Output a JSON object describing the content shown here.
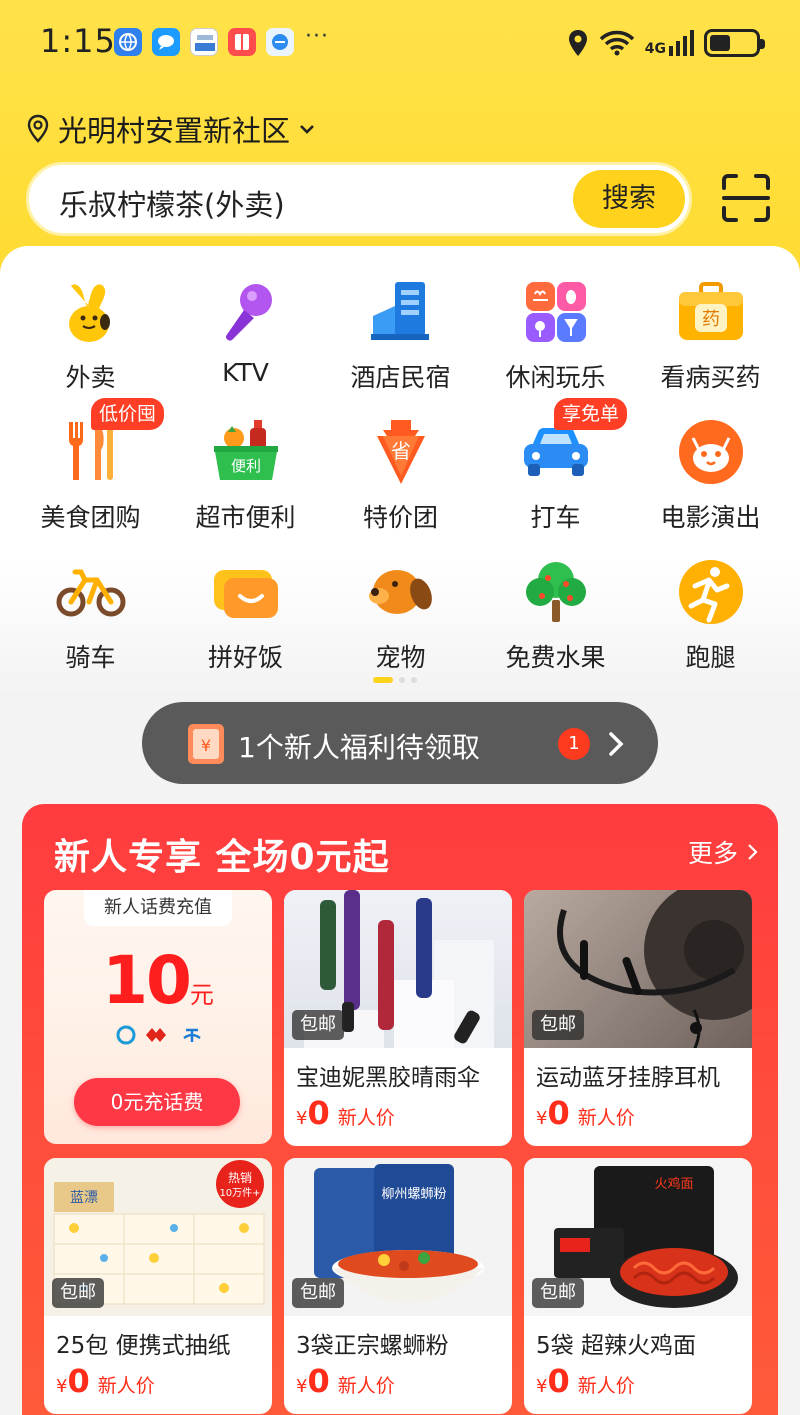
{
  "status_bar": {
    "time": "1:15",
    "dots": "···",
    "network": "4G",
    "battery_percent": 45
  },
  "location": {
    "label": "光明村安置新社区"
  },
  "search": {
    "query": "乐叔柠檬茶(外卖)",
    "button_label": "搜索"
  },
  "categories": [
    {
      "label": "外卖",
      "icon": "takeout-icon"
    },
    {
      "label": "KTV",
      "icon": "microphone-icon"
    },
    {
      "label": "酒店民宿",
      "icon": "hotel-icon"
    },
    {
      "label": "休闲玩乐",
      "icon": "leisure-icon"
    },
    {
      "label": "看病买药",
      "icon": "medicine-box-icon"
    },
    {
      "label": "美食团购",
      "icon": "fork-knife-icon",
      "tag": "低价囤"
    },
    {
      "label": "超市便利",
      "icon": "grocery-basket-icon"
    },
    {
      "label": "特价团",
      "icon": "discount-icon"
    },
    {
      "label": "打车",
      "icon": "car-icon",
      "tag": "享免单"
    },
    {
      "label": "电影演出",
      "icon": "cat-face-icon"
    },
    {
      "label": "骑车",
      "icon": "bicycle-icon"
    },
    {
      "label": "拼好饭",
      "icon": "smile-box-icon"
    },
    {
      "label": "宠物",
      "icon": "dog-icon"
    },
    {
      "label": "免费水果",
      "icon": "tree-icon"
    },
    {
      "label": "跑腿",
      "icon": "runner-icon"
    }
  ],
  "grocery_badge": "便利",
  "discount_badge": "省",
  "medicine_badge": "药",
  "notice": {
    "text": "1个新人福利待领取",
    "badge_count": "1",
    "voucher_symbol": "¥"
  },
  "promo": {
    "title": "新人专享 全场0元起",
    "more_label": "更多",
    "recharge": {
      "title": "新人话费充值",
      "amount": "10",
      "unit": "元",
      "button_label": "0元充话费"
    },
    "products": [
      {
        "name": "宝迪妮黑胶晴雨伞",
        "ship": "包邮",
        "currency": "¥",
        "price": "0",
        "price_label": "新人价"
      },
      {
        "name": "运动蓝牙挂脖耳机",
        "ship": "包邮",
        "currency": "¥",
        "price": "0",
        "price_label": "新人价"
      },
      {
        "name": "25包 便携式抽纸",
        "ship": "包邮",
        "currency": "¥",
        "price": "0",
        "price_label": "新人价",
        "sticker": [
          "热销",
          "10万件+"
        ],
        "brand": "蓝漂"
      },
      {
        "name": "3袋正宗螺蛳粉",
        "ship": "包邮",
        "currency": "¥",
        "price": "0",
        "price_label": "新人价",
        "package_text": "柳州螺蛳粉"
      },
      {
        "name": "5袋 超辣火鸡面",
        "ship": "包邮",
        "currency": "¥",
        "price": "0",
        "price_label": "新人价",
        "package_text": "火鸡面"
      }
    ]
  },
  "colors": {
    "brand_yellow": "#ffd21e",
    "promo_red": "#ff3b3f",
    "price_red": "#ff2d1a"
  }
}
